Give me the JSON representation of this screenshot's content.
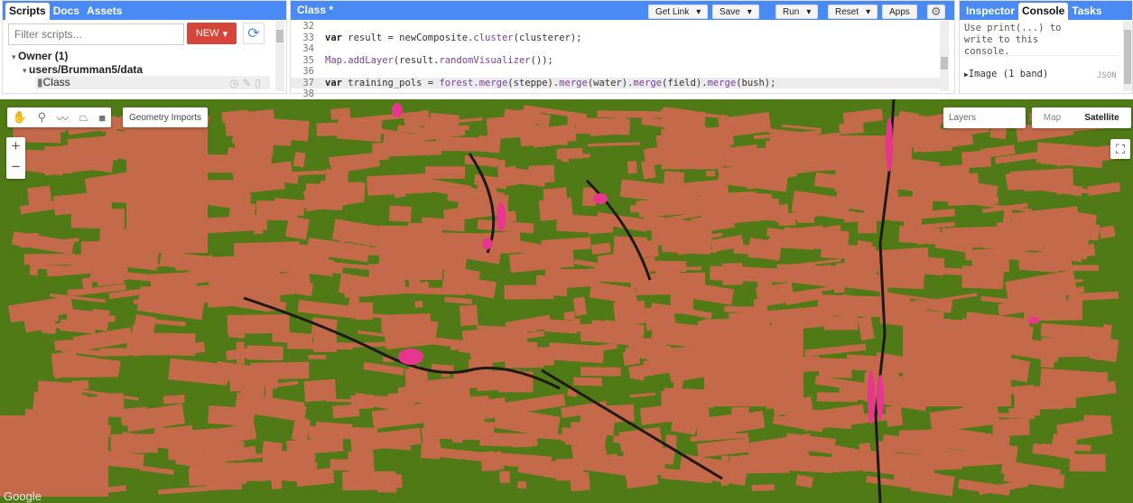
{
  "left_panel": {
    "tabs": [
      "Scripts",
      "Docs",
      "Assets"
    ],
    "active_tab": "Scripts",
    "filter_placeholder": "Filter scripts...",
    "new_label": "NEW",
    "tree": {
      "owner": "Owner (1)",
      "repo": "users/Brumman5/data",
      "file": "Class"
    }
  },
  "editor": {
    "title": "Class *",
    "buttons": {
      "get_link": "Get Link",
      "save": "Save",
      "run": "Run",
      "reset": "Reset",
      "apps": "Apps"
    },
    "lines": [
      {
        "n": "32",
        "parts": []
      },
      {
        "n": "33",
        "parts": [
          [
            "kw",
            "var"
          ],
          [
            "tx",
            " result = newComposite."
          ],
          [
            "fn",
            "cluster"
          ],
          [
            "tx",
            "(clusterer);"
          ]
        ]
      },
      {
        "n": "34",
        "parts": []
      },
      {
        "n": "35",
        "parts": [
          [
            "fn",
            "Map.addLayer"
          ],
          [
            "tx",
            "(result."
          ],
          [
            "fn",
            "randomVisualizer"
          ],
          [
            "tx",
            "());"
          ]
        ]
      },
      {
        "n": "36",
        "parts": []
      },
      {
        "n": "37",
        "parts": [
          [
            "kw",
            "var"
          ],
          [
            "tx",
            " training_pols = "
          ],
          [
            "fn",
            "forest.merge"
          ],
          [
            "tx",
            "(steppe)."
          ],
          [
            "fn",
            "merge"
          ],
          [
            "tx",
            "(water)."
          ],
          [
            "fn",
            "merge"
          ],
          [
            "tx",
            "(field)."
          ],
          [
            "fn",
            "merge"
          ],
          [
            "tx",
            "(bush);"
          ]
        ]
      },
      {
        "n": "38",
        "parts": []
      }
    ]
  },
  "right_panel": {
    "tabs": [
      "Inspector",
      "Console",
      "Tasks"
    ],
    "active_tab": "Console",
    "console_hint": "Use print(...) to write to this console.",
    "output_item": "Image (1 band)",
    "json_label": "JSON"
  },
  "map": {
    "geometry_imports": "Geometry Imports",
    "layers": "Layers",
    "map_type": "Map",
    "satellite": "Satellite",
    "zoom_in": "+",
    "zoom_out": "−",
    "attribution": "Google",
    "colors": {
      "forest": "#4f7a15",
      "field": "#c4694a",
      "water": "#e8358f",
      "dark": "#1f1a18"
    }
  }
}
